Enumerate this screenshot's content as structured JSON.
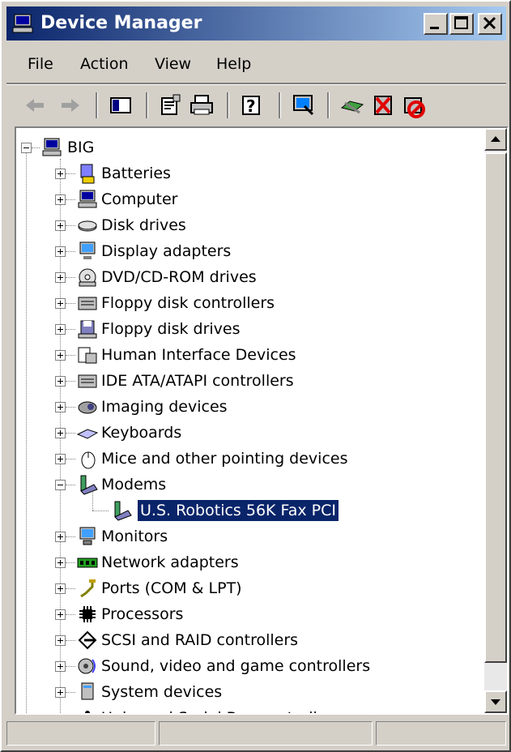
{
  "window": {
    "title": "Device Manager",
    "colors": {
      "titlebar_start": "#0a246a",
      "titlebar_end": "#a6caf0",
      "selection": "#0a246a",
      "face": "#d4d0c8"
    }
  },
  "title_buttons": [
    "minimize-icon",
    "maximize-icon",
    "close-icon"
  ],
  "menu": [
    "File",
    "Action",
    "View",
    "Help"
  ],
  "toolbar": {
    "icons": [
      "back-arrow-icon",
      "forward-arrow-icon",
      "show-hide-console-tree-icon",
      "properties-icon",
      "print-icon",
      "help-icon",
      "scan-hardware-changes-icon",
      "update-driver-icon",
      "uninstall-icon",
      "disable-device-icon"
    ]
  },
  "tree": {
    "root": {
      "label": "BIG",
      "expanded": true,
      "icon": "computer-icon"
    },
    "items": [
      {
        "label": "Batteries",
        "expanded": false,
        "icon": "battery-icon"
      },
      {
        "label": "Computer",
        "expanded": false,
        "icon": "computer-icon"
      },
      {
        "label": "Disk drives",
        "expanded": false,
        "icon": "disk-drive-icon"
      },
      {
        "label": "Display adapters",
        "expanded": false,
        "icon": "display-adapter-icon"
      },
      {
        "label": "DVD/CD-ROM drives",
        "expanded": false,
        "icon": "cdrom-icon"
      },
      {
        "label": "Floppy disk controllers",
        "expanded": false,
        "icon": "controller-icon"
      },
      {
        "label": "Floppy disk drives",
        "expanded": false,
        "icon": "floppy-icon"
      },
      {
        "label": "Human Interface Devices",
        "expanded": false,
        "icon": "hid-icon"
      },
      {
        "label": "IDE ATA/ATAPI controllers",
        "expanded": false,
        "icon": "controller-icon"
      },
      {
        "label": "Imaging devices",
        "expanded": false,
        "icon": "camera-icon"
      },
      {
        "label": "Keyboards",
        "expanded": false,
        "icon": "keyboard-icon"
      },
      {
        "label": "Mice and other pointing devices",
        "expanded": false,
        "icon": "mouse-icon"
      },
      {
        "label": "Modems",
        "expanded": true,
        "icon": "modem-icon",
        "children": [
          {
            "label": "U.S. Robotics 56K Fax PCI",
            "selected": true,
            "icon": "modem-icon"
          }
        ]
      },
      {
        "label": "Monitors",
        "expanded": false,
        "icon": "monitor-icon"
      },
      {
        "label": "Network adapters",
        "expanded": false,
        "icon": "network-adapter-icon"
      },
      {
        "label": "Ports (COM & LPT)",
        "expanded": false,
        "icon": "port-icon"
      },
      {
        "label": "Processors",
        "expanded": false,
        "icon": "processor-icon"
      },
      {
        "label": "SCSI and RAID controllers",
        "expanded": false,
        "icon": "scsi-icon"
      },
      {
        "label": "Sound, video and game controllers",
        "expanded": false,
        "icon": "sound-icon"
      },
      {
        "label": "System devices",
        "expanded": false,
        "icon": "system-icon"
      },
      {
        "label": "Universal Serial Bus controllers",
        "expanded": false,
        "icon": "usb-icon"
      }
    ]
  },
  "scrollbar": {
    "position": 0.0
  },
  "status": [
    "",
    "",
    ""
  ]
}
